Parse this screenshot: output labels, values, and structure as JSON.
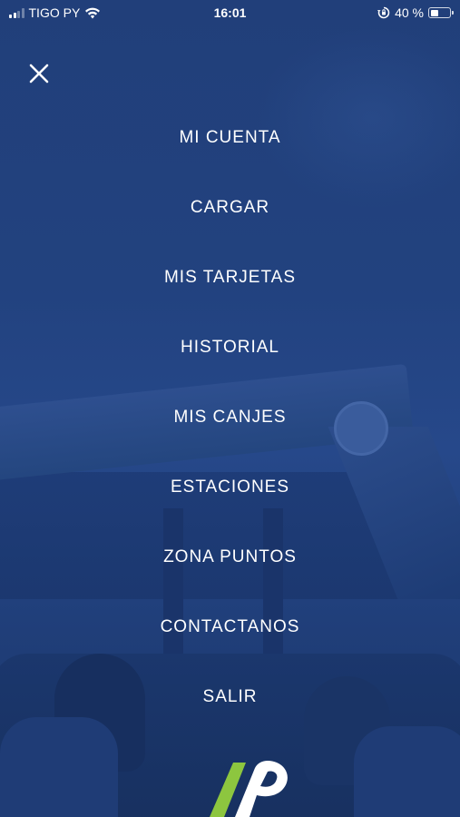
{
  "status_bar": {
    "carrier": "TIGO PY",
    "time": "16:01",
    "battery_percent": "40 %",
    "battery_level": 0.4,
    "icons": [
      "signal-icon",
      "wifi-icon",
      "orientation-lock-icon",
      "battery-icon"
    ]
  },
  "menu": {
    "close_icon": "close-icon",
    "items": [
      {
        "label": "MI CUENTA"
      },
      {
        "label": "CARGAR"
      },
      {
        "label": "MIS TARJETAS"
      },
      {
        "label": "HISTORIAL"
      },
      {
        "label": "MIS CANJES"
      },
      {
        "label": "ESTACIONES"
      },
      {
        "label": "ZONA PUNTOS"
      },
      {
        "label": "CONTACTANOS"
      },
      {
        "label": "SALIR"
      }
    ]
  },
  "colors": {
    "background": "#1f3f7c",
    "text": "#ffffff",
    "logo_green": "#8dc63f",
    "logo_white": "#ffffff"
  },
  "brand": {
    "logo_icon": "petrol-brand-logo-icon"
  }
}
